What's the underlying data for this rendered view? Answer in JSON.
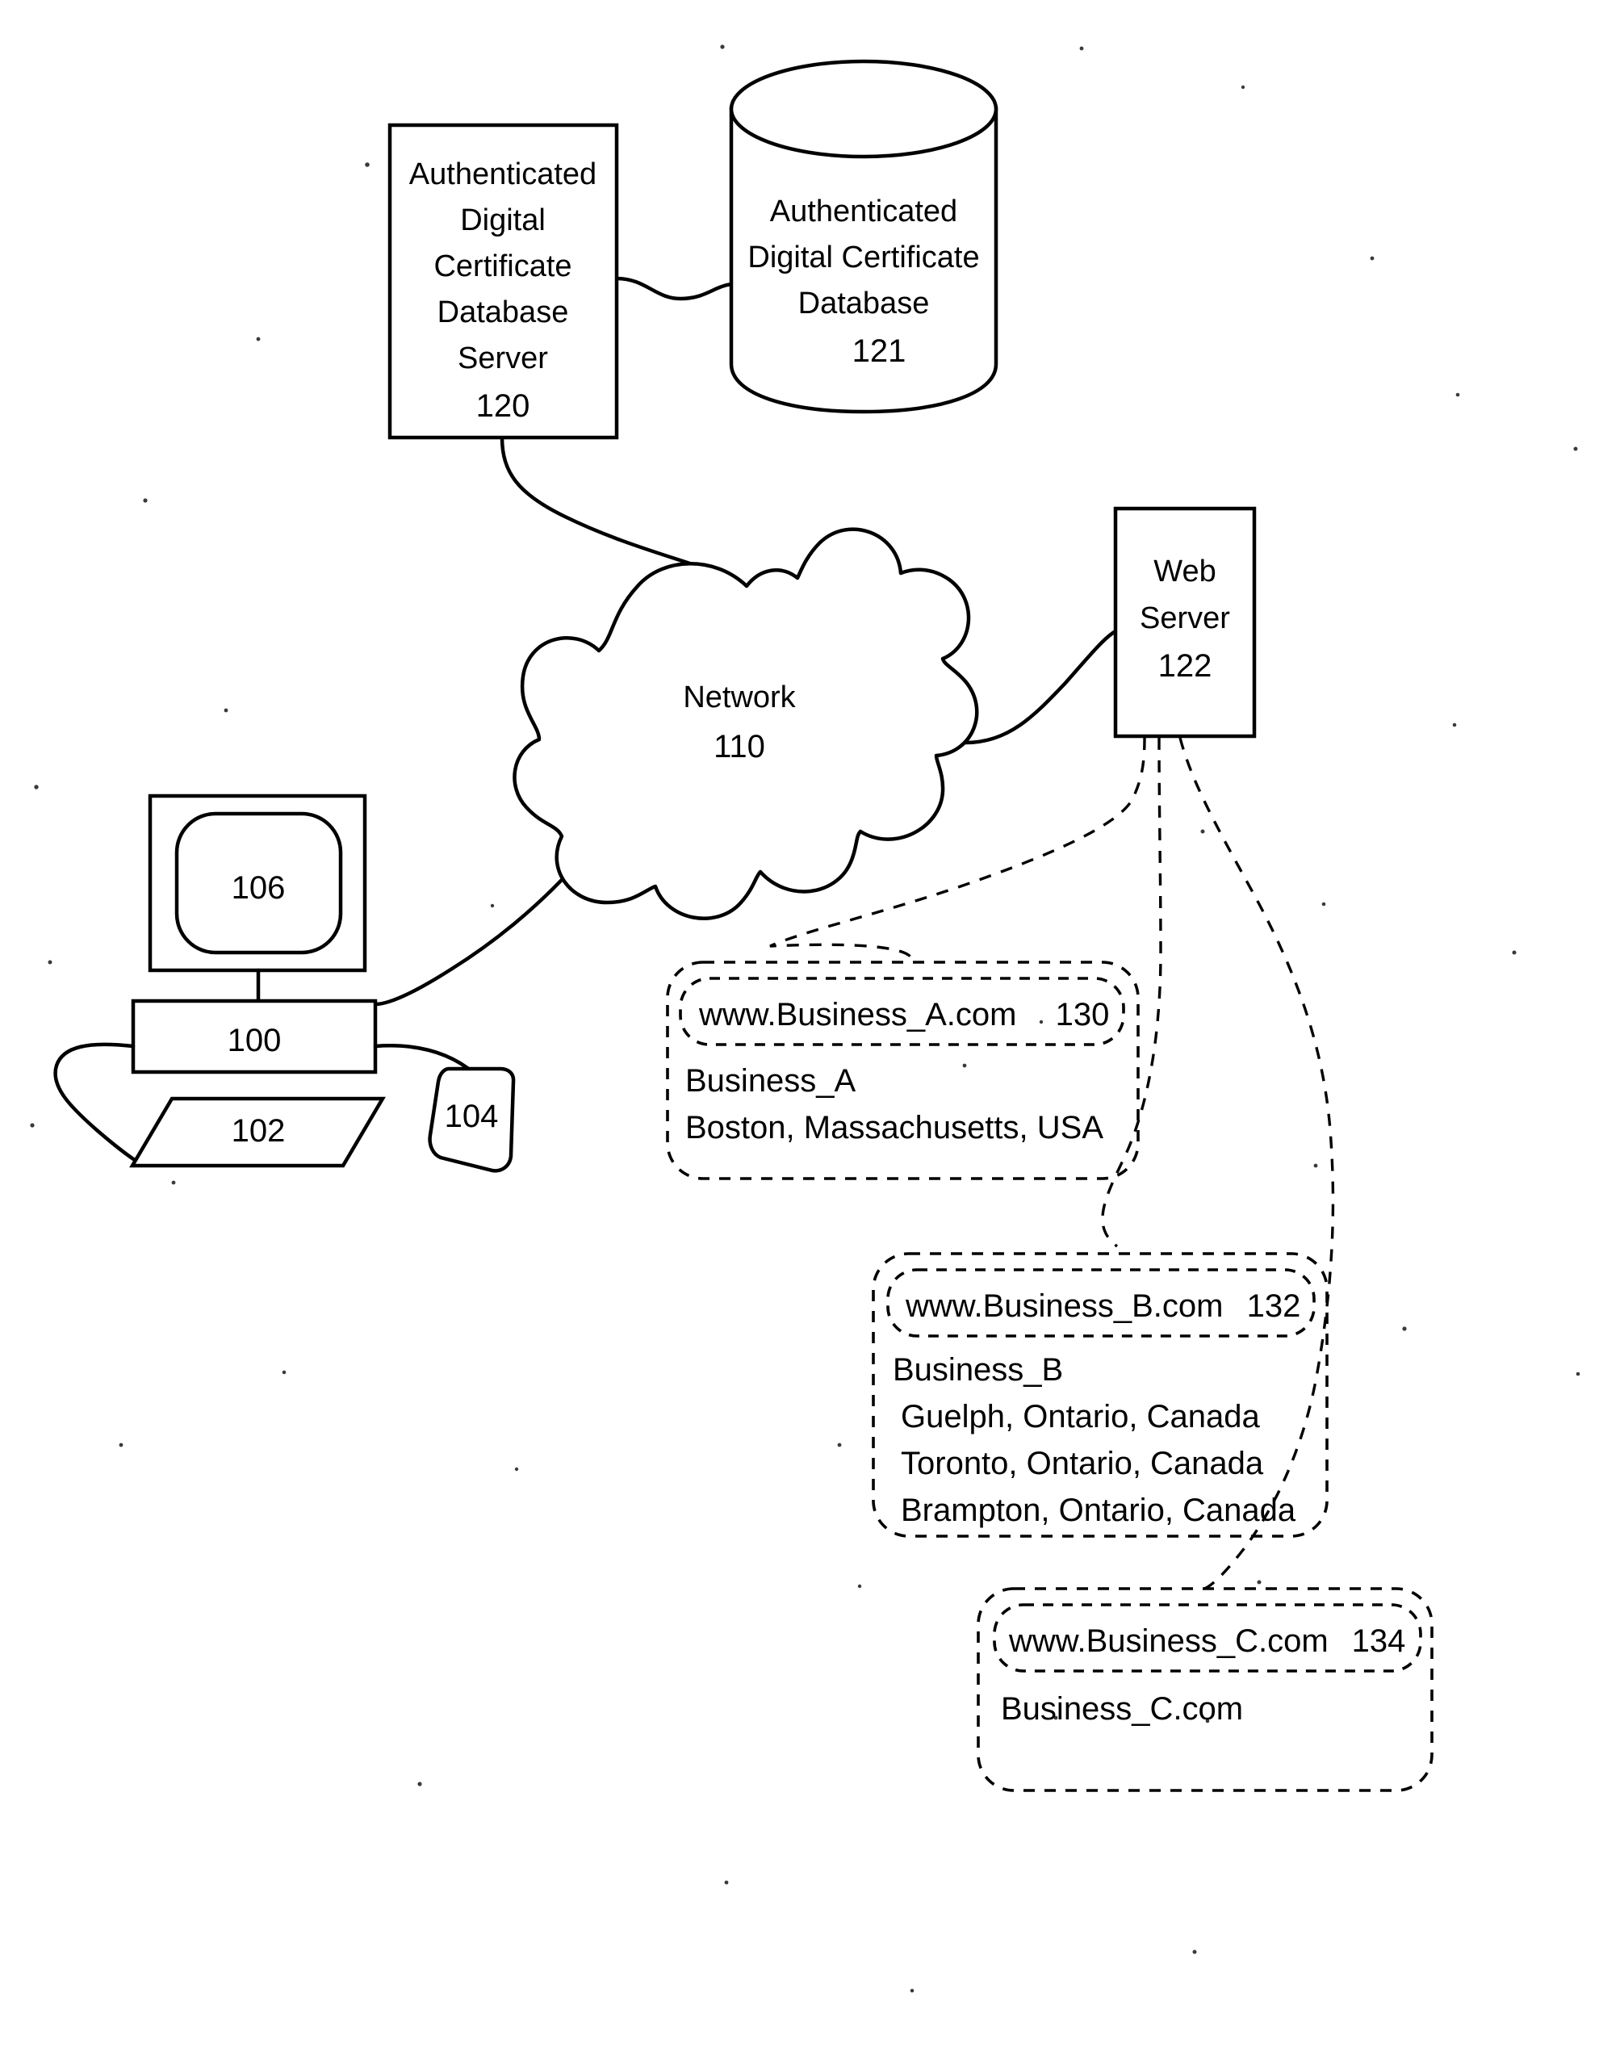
{
  "figure": {
    "title": "Authenticated Digital Certificate Network Diagram",
    "background_color": "#ffffff",
    "line_color": "#000000"
  },
  "nodes": {
    "cert_db_server": {
      "name": "Authenticated Digital Certificate Database Server",
      "lines": [
        "Authenticated",
        "Digital",
        "Certificate",
        "Database",
        "Server"
      ],
      "ref": "120",
      "shape": "rectangle"
    },
    "cert_db": {
      "name": "Authenticated Digital Certificate Database",
      "lines": [
        "Authenticated",
        "Digital Certificate",
        "Database"
      ],
      "ref": "121",
      "shape": "cylinder"
    },
    "network": {
      "label": "Network",
      "ref": "110",
      "shape": "cloud"
    },
    "web_server": {
      "lines": [
        "Web",
        "Server"
      ],
      "ref": "122",
      "shape": "rectangle"
    },
    "monitor": {
      "ref": "106",
      "shape": "monitor"
    },
    "computer": {
      "ref": "100",
      "shape": "rectangle"
    },
    "keyboard": {
      "ref": "102",
      "shape": "parallelogram"
    },
    "mouse": {
      "ref": "104",
      "shape": "rounded-blob"
    }
  },
  "websites": [
    {
      "id": "business-a",
      "url": "www.Business_A.com",
      "ref": "130",
      "body": [
        "Business_A",
        "Boston, Massachusetts, USA"
      ]
    },
    {
      "id": "business-b",
      "url": "www.Business_B.com",
      "ref": "132",
      "body": [
        "Business_B",
        "Guelph, Ontario, Canada",
        "Toronto, Ontario, Canada",
        "Brampton, Ontario, Canada"
      ]
    },
    {
      "id": "business-c",
      "url": "www.Business_C.com",
      "ref": "134",
      "body": [
        "Business_C.com"
      ]
    }
  ],
  "connections": [
    {
      "from": "cert_db_server",
      "to": "cert_db",
      "style": "solid"
    },
    {
      "from": "cert_db_server",
      "to": "network",
      "style": "solid"
    },
    {
      "from": "network",
      "to": "web_server",
      "style": "solid"
    },
    {
      "from": "network",
      "to": "computer",
      "style": "solid"
    },
    {
      "from": "computer",
      "to": "monitor",
      "style": "solid"
    },
    {
      "from": "computer",
      "to": "keyboard",
      "style": "solid"
    },
    {
      "from": "computer",
      "to": "mouse",
      "style": "solid"
    },
    {
      "from": "web_server",
      "to": "business-a",
      "style": "dashed"
    },
    {
      "from": "web_server",
      "to": "business-b",
      "style": "dashed"
    },
    {
      "from": "web_server",
      "to": "business-c",
      "style": "dashed"
    }
  ]
}
